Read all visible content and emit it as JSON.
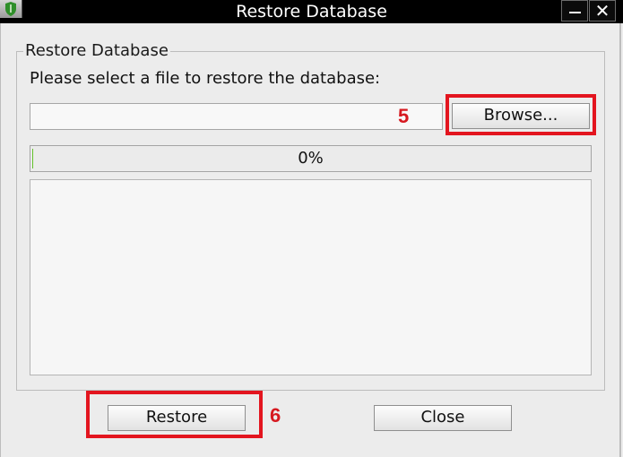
{
  "window": {
    "title": "Restore Database",
    "icons": {
      "app": "shield-icon",
      "minimize": "minimize-icon",
      "close": "close-icon"
    },
    "close_glyph": "✕"
  },
  "group": {
    "legend": "Restore Database"
  },
  "form": {
    "prompt": "Please select a file to restore the database:",
    "file_path_value": "",
    "browse_label": "Browse..."
  },
  "progress": {
    "text": "0%",
    "value": 0,
    "fill_color": "#63c22a"
  },
  "buttons": {
    "restore_label": "Restore",
    "close_label": "Close"
  },
  "annotations": {
    "step_5": "5",
    "step_6": "6",
    "highlight_color": "#e3151f"
  }
}
